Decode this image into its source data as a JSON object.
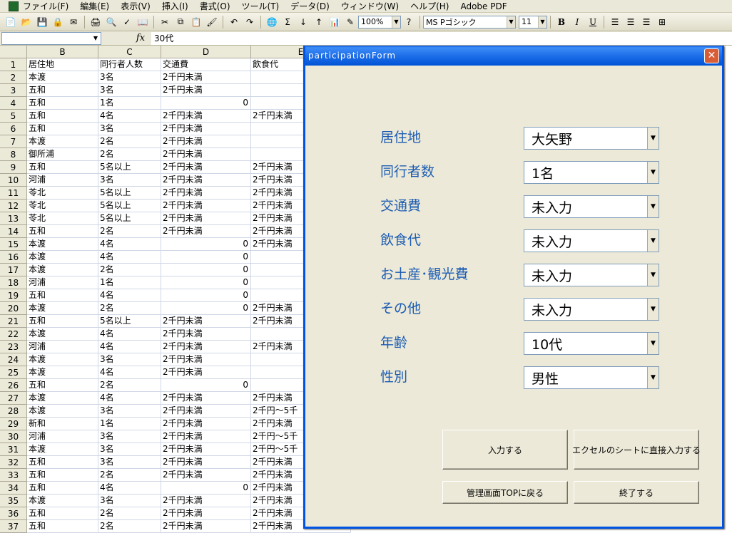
{
  "menu": {
    "items": [
      "ファイル(F)",
      "編集(E)",
      "表示(V)",
      "挿入(I)",
      "書式(O)",
      "ツール(T)",
      "データ(D)",
      "ウィンドウ(W)",
      "ヘルプ(H)",
      "Adobe PDF"
    ]
  },
  "toolbar": {
    "zoom": "100%",
    "font_name": "MS Pゴシック",
    "font_size": "11",
    "bold_label": "B",
    "italic_label": "I",
    "underline_label": "U"
  },
  "formula_bar": {
    "name_box": "",
    "fx_label": "fx",
    "value": "30代"
  },
  "sheet": {
    "columns": [
      "B",
      "C",
      "D",
      "E"
    ],
    "rows": [
      {
        "n": "1",
        "b": "居住地",
        "c": "同行者人数",
        "d": "交通費",
        "e": "飲食代"
      },
      {
        "n": "2",
        "b": "本渡",
        "c": "3名",
        "d": "2千円未満",
        "e": ""
      },
      {
        "n": "3",
        "b": "五和",
        "c": "3名",
        "d": "2千円未満",
        "e": ""
      },
      {
        "n": "4",
        "b": "五和",
        "c": "1名",
        "d": "0",
        "e": ""
      },
      {
        "n": "5",
        "b": "五和",
        "c": "4名",
        "d": "2千円未満",
        "e": "2千円未満"
      },
      {
        "n": "6",
        "b": "五和",
        "c": "3名",
        "d": "2千円未満",
        "e": ""
      },
      {
        "n": "7",
        "b": "本渡",
        "c": "2名",
        "d": "2千円未満",
        "e": ""
      },
      {
        "n": "8",
        "b": "御所浦",
        "c": "2名",
        "d": "2千円未満",
        "e": ""
      },
      {
        "n": "9",
        "b": "五和",
        "c": "5名以上",
        "d": "2千円未満",
        "e": "2千円未満"
      },
      {
        "n": "10",
        "b": "河浦",
        "c": "3名",
        "d": "2千円未満",
        "e": "2千円未満"
      },
      {
        "n": "11",
        "b": "苓北",
        "c": "5名以上",
        "d": "2千円未満",
        "e": "2千円未満"
      },
      {
        "n": "12",
        "b": "苓北",
        "c": "5名以上",
        "d": "2千円未満",
        "e": "2千円未満"
      },
      {
        "n": "13",
        "b": "苓北",
        "c": "5名以上",
        "d": "2千円未満",
        "e": "2千円未満"
      },
      {
        "n": "14",
        "b": "五和",
        "c": "2名",
        "d": "2千円未満",
        "e": "2千円未満"
      },
      {
        "n": "15",
        "b": "本渡",
        "c": "4名",
        "d": "0",
        "e": "2千円未満"
      },
      {
        "n": "16",
        "b": "本渡",
        "c": "4名",
        "d": "0",
        "e": ""
      },
      {
        "n": "17",
        "b": "本渡",
        "c": "2名",
        "d": "0",
        "e": ""
      },
      {
        "n": "18",
        "b": "河浦",
        "c": "1名",
        "d": "0",
        "e": ""
      },
      {
        "n": "19",
        "b": "五和",
        "c": "4名",
        "d": "0",
        "e": ""
      },
      {
        "n": "20",
        "b": "本渡",
        "c": "2名",
        "d": "0",
        "e": "2千円未満"
      },
      {
        "n": "21",
        "b": "五和",
        "c": "5名以上",
        "d": "2千円未満",
        "e": "2千円未満"
      },
      {
        "n": "22",
        "b": "本渡",
        "c": "4名",
        "d": "2千円未満",
        "e": ""
      },
      {
        "n": "23",
        "b": "河浦",
        "c": "4名",
        "d": "2千円未満",
        "e": "2千円未満"
      },
      {
        "n": "24",
        "b": "本渡",
        "c": "3名",
        "d": "2千円未満",
        "e": ""
      },
      {
        "n": "25",
        "b": "本渡",
        "c": "4名",
        "d": "2千円未満",
        "e": ""
      },
      {
        "n": "26",
        "b": "五和",
        "c": "2名",
        "d": "0",
        "e": ""
      },
      {
        "n": "27",
        "b": "本渡",
        "c": "4名",
        "d": "2千円未満",
        "e": "2千円未満"
      },
      {
        "n": "28",
        "b": "本渡",
        "c": "3名",
        "d": "2千円未満",
        "e": "2千円～5千"
      },
      {
        "n": "29",
        "b": "新和",
        "c": "1名",
        "d": "2千円未満",
        "e": "2千円未満"
      },
      {
        "n": "30",
        "b": "河浦",
        "c": "3名",
        "d": "2千円未満",
        "e": "2千円～5千"
      },
      {
        "n": "31",
        "b": "本渡",
        "c": "3名",
        "d": "2千円未満",
        "e": "2千円～5千"
      },
      {
        "n": "32",
        "b": "五和",
        "c": "3名",
        "d": "2千円未満",
        "e": "2千円未満"
      },
      {
        "n": "33",
        "b": "五和",
        "c": "2名",
        "d": "2千円未満",
        "e": "2千円未満"
      },
      {
        "n": "34",
        "b": "五和",
        "c": "4名",
        "d": "0",
        "e": "2千円未満"
      },
      {
        "n": "35",
        "b": "本渡",
        "c": "3名",
        "d": "2千円未満",
        "e": "2千円未満"
      },
      {
        "n": "36",
        "b": "五和",
        "c": "2名",
        "d": "2千円未満",
        "e": "2千円未満"
      },
      {
        "n": "37",
        "b": "五和",
        "c": "2名",
        "d": "2千円未満",
        "e": "2千円未満"
      }
    ]
  },
  "dialog": {
    "title": "participationForm",
    "close_label": "✕",
    "fields": [
      {
        "label": "居住地",
        "value": "大矢野"
      },
      {
        "label": "同行者数",
        "value": "1名"
      },
      {
        "label": "交通費",
        "value": "未入力"
      },
      {
        "label": "飲食代",
        "value": "未入力"
      },
      {
        "label": "お土産･観光費",
        "value": "未入力"
      },
      {
        "label": "その他",
        "value": "未入力"
      },
      {
        "label": "年齢",
        "value": "10代"
      },
      {
        "label": "性別",
        "value": "男性"
      }
    ],
    "buttons": {
      "input": "入力する",
      "direct_input": "エクセルのシートに直接入力する",
      "admin_top": "管理画面TOPに戻る",
      "exit": "終了する"
    }
  }
}
